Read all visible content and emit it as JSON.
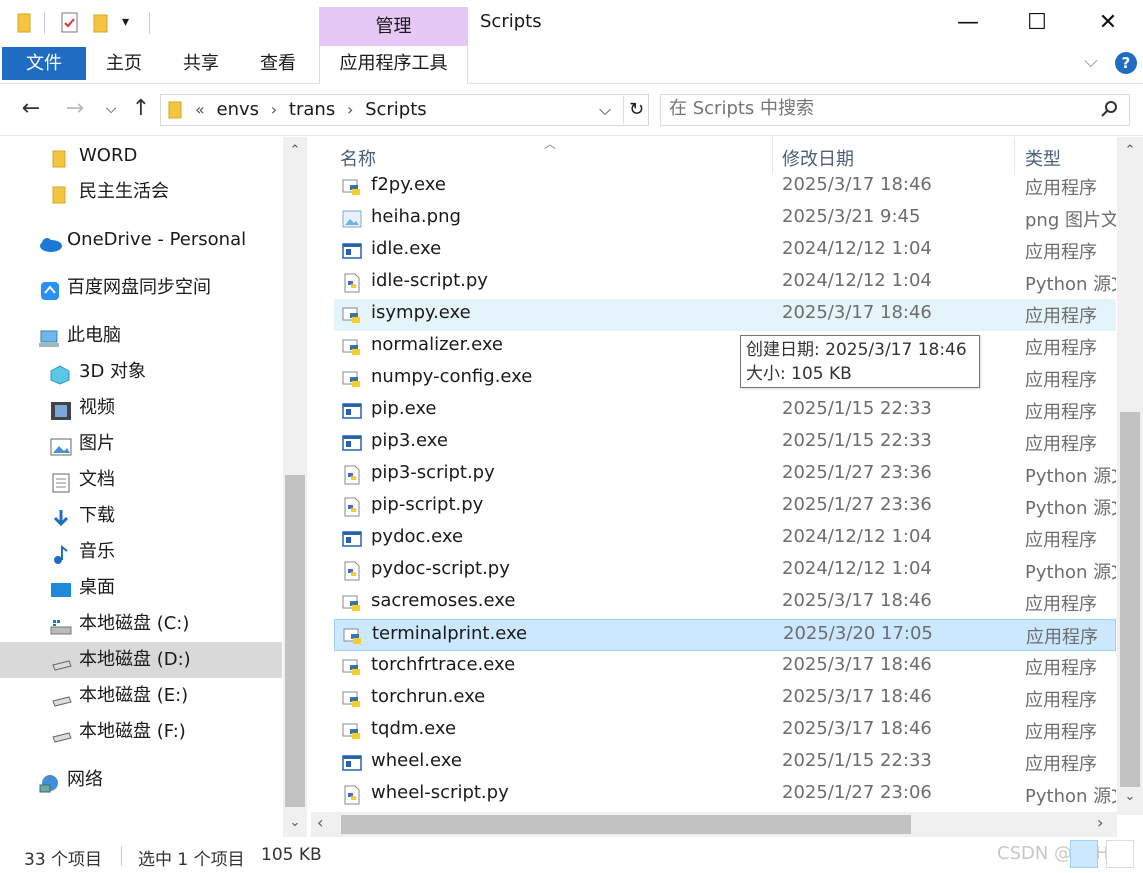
{
  "window": {
    "title": "Scripts",
    "context_tab": "管理",
    "minimize": "—",
    "maximize": "☐",
    "close": "✕"
  },
  "ribbon": {
    "file_tab": "文件",
    "tabs": [
      "主页",
      "共享",
      "查看"
    ],
    "app_tools_tab": "应用程序工具",
    "expand": "⌵",
    "help": "?"
  },
  "address": {
    "overflow": "«",
    "crumbs": [
      "envs",
      "trans",
      "Scripts"
    ],
    "sep": "›",
    "refresh": "↻",
    "dropdown": "⌵"
  },
  "search": {
    "placeholder": "在 Scripts 中搜索"
  },
  "nav": {
    "items": [
      {
        "label": "WORD",
        "icon": "folder-icon"
      },
      {
        "label": "民主生活会",
        "icon": "folder-icon"
      },
      {
        "label": "OneDrive - Personal",
        "icon": "cloud-icon"
      },
      {
        "label": "百度网盘同步空间",
        "icon": "baidu-icon"
      },
      {
        "label": "此电脑",
        "icon": "computer-icon"
      },
      {
        "label": "3D 对象",
        "icon": "cube-icon"
      },
      {
        "label": "视频",
        "icon": "video-icon"
      },
      {
        "label": "图片",
        "icon": "picture-icon"
      },
      {
        "label": "文档",
        "icon": "document-icon"
      },
      {
        "label": "下载",
        "icon": "download-icon"
      },
      {
        "label": "音乐",
        "icon": "music-icon"
      },
      {
        "label": "桌面",
        "icon": "desktop-icon"
      },
      {
        "label": "本地磁盘 (C:)",
        "icon": "drive-icon"
      },
      {
        "label": "本地磁盘 (D:)",
        "icon": "drive-icon"
      },
      {
        "label": "本地磁盘 (E:)",
        "icon": "drive-icon"
      },
      {
        "label": "本地磁盘 (F:)",
        "icon": "drive-icon"
      },
      {
        "label": "网络",
        "icon": "network-icon"
      }
    ]
  },
  "columns": {
    "name": "名称",
    "date": "修改日期",
    "type": "类型"
  },
  "files": [
    {
      "name": "f2py.exe",
      "date": "2025/3/17 18:46",
      "type": "应用程序",
      "icon": "python-exe-icon"
    },
    {
      "name": "heiha.png",
      "date": "2025/3/21 9:45",
      "type": "png 图片文件",
      "icon": "png-icon"
    },
    {
      "name": "idle.exe",
      "date": "2024/12/12 1:04",
      "type": "应用程序",
      "icon": "window-exe-icon"
    },
    {
      "name": "idle-script.py",
      "date": "2024/12/12 1:04",
      "type": "Python 源文件",
      "icon": "python-file-icon"
    },
    {
      "name": "isympy.exe",
      "date": "2025/3/17 18:46",
      "type": "应用程序",
      "icon": "python-exe-icon"
    },
    {
      "name": "normalizer.exe",
      "date": "",
      "type": "应用程序",
      "icon": "python-exe-icon"
    },
    {
      "name": "numpy-config.exe",
      "date": "",
      "type": "应用程序",
      "icon": "python-exe-icon"
    },
    {
      "name": "pip.exe",
      "date": "2025/1/15 22:33",
      "type": "应用程序",
      "icon": "window-exe-icon"
    },
    {
      "name": "pip3.exe",
      "date": "2025/1/15 22:33",
      "type": "应用程序",
      "icon": "window-exe-icon"
    },
    {
      "name": "pip3-script.py",
      "date": "2025/1/27 23:36",
      "type": "Python 源文件",
      "icon": "python-file-icon"
    },
    {
      "name": "pip-script.py",
      "date": "2025/1/27 23:36",
      "type": "Python 源文件",
      "icon": "python-file-icon"
    },
    {
      "name": "pydoc.exe",
      "date": "2024/12/12 1:04",
      "type": "应用程序",
      "icon": "window-exe-icon"
    },
    {
      "name": "pydoc-script.py",
      "date": "2024/12/12 1:04",
      "type": "Python 源文件",
      "icon": "python-file-icon"
    },
    {
      "name": "sacremoses.exe",
      "date": "2025/3/17 18:46",
      "type": "应用程序",
      "icon": "python-exe-icon"
    },
    {
      "name": "terminalprint.exe",
      "date": "2025/3/20 17:05",
      "type": "应用程序",
      "icon": "python-exe-icon"
    },
    {
      "name": "torchfrtrace.exe",
      "date": "2025/3/17 18:46",
      "type": "应用程序",
      "icon": "python-exe-icon"
    },
    {
      "name": "torchrun.exe",
      "date": "2025/3/17 18:46",
      "type": "应用程序",
      "icon": "python-exe-icon"
    },
    {
      "name": "tqdm.exe",
      "date": "2025/3/17 18:46",
      "type": "应用程序",
      "icon": "python-exe-icon"
    },
    {
      "name": "wheel.exe",
      "date": "2025/1/15 22:33",
      "type": "应用程序",
      "icon": "window-exe-icon"
    },
    {
      "name": "wheel-script.py",
      "date": "2025/1/27 23:06",
      "type": "Python 源文件",
      "icon": "python-file-icon"
    }
  ],
  "tooltip": {
    "line1": "创建日期: 2025/3/17 18:46",
    "line2": "大小: 105 KB"
  },
  "status": {
    "count": "33 个项目",
    "selection": "选中 1 个项目",
    "size": "105 KB",
    "watermark": "CSDN @KEH"
  },
  "colors": {
    "accent": "#1f6cc2",
    "context_tab": "#e6c7f5",
    "hover": "#e5f3fb",
    "selected": "#cce8ff"
  }
}
